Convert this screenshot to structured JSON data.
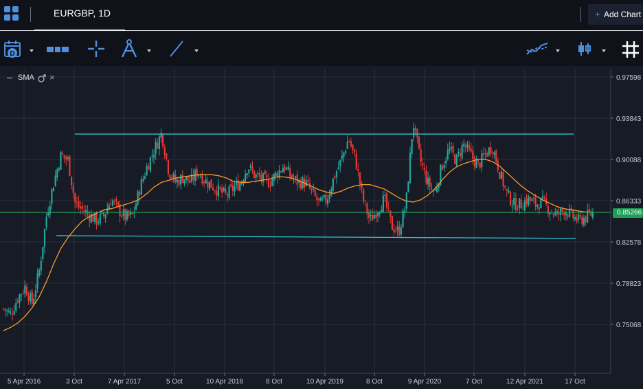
{
  "header": {
    "symbol_tab": "EURGBP, 1D",
    "add_chart_label": "Add Chart",
    "add_chart_plus": "+"
  },
  "toolbar": {
    "tools": [
      "calendar-date-icon",
      "range-bar-icon",
      "crosshair-icon",
      "compass-drawing-icon",
      "trend-line-icon",
      "indicators-icon",
      "candlestick-type-icon",
      "grid-icon"
    ]
  },
  "indicator": {
    "label": "SMA",
    "dash": "—",
    "close": "×"
  },
  "colors": {
    "up": "#26a69a",
    "down": "#e53935",
    "sma": "#f59b2c",
    "channel": "#29c4d1",
    "price_line": "#1f9d55",
    "grid": "#2a2f3b",
    "bg": "#171b26",
    "accent": "#4f8fdc"
  },
  "chart_data": {
    "type": "candlestick",
    "title": "EURGBP, 1D",
    "x_ticks": [
      "5 Apr 2016",
      "3 Oct",
      "7 Apr 2017",
      "5 Oct",
      "10 Apr 2018",
      "8 Oct",
      "10 Apr 2019",
      "8 Oct",
      "9 Apr 2020",
      "7 Oct",
      "12 Apr 2021",
      "17 Oct"
    ],
    "y_ticks": [
      "0.97598",
      "0.93843",
      "0.90088",
      "0.86333",
      "0.82578",
      "0.78823",
      "0.75068"
    ],
    "ylim": [
      0.7444,
      0.982
    ],
    "last_price": "0.85266",
    "indicators": [
      "SMA"
    ],
    "price_series_monthly": [
      0.765,
      0.76,
      0.775,
      0.785,
      0.77,
      0.8,
      0.85,
      0.88,
      0.905,
      0.9,
      0.86,
      0.855,
      0.85,
      0.845,
      0.85,
      0.865,
      0.855,
      0.848,
      0.85,
      0.875,
      0.895,
      0.91,
      0.925,
      0.89,
      0.88,
      0.885,
      0.88,
      0.89,
      0.882,
      0.877,
      0.872,
      0.868,
      0.875,
      0.88,
      0.895,
      0.886,
      0.883,
      0.88,
      0.888,
      0.895,
      0.885,
      0.88,
      0.88,
      0.87,
      0.86,
      0.865,
      0.885,
      0.9,
      0.92,
      0.9,
      0.865,
      0.845,
      0.855,
      0.865,
      0.84,
      0.835,
      0.86,
      0.935,
      0.9,
      0.88,
      0.87,
      0.895,
      0.91,
      0.9,
      0.915,
      0.905,
      0.895,
      0.905,
      0.913,
      0.89,
      0.87,
      0.86,
      0.86,
      0.865,
      0.86,
      0.862,
      0.855,
      0.85,
      0.855,
      0.85,
      0.845,
      0.848,
      0.852
    ],
    "sma_series_monthly": [
      0.745,
      0.748,
      0.752,
      0.758,
      0.766,
      0.776,
      0.79,
      0.806,
      0.82,
      0.83,
      0.838,
      0.845,
      0.849,
      0.852,
      0.855,
      0.856,
      0.858,
      0.86,
      0.862,
      0.865,
      0.87,
      0.876,
      0.88,
      0.882,
      0.884,
      0.885,
      0.886,
      0.887,
      0.887,
      0.887,
      0.886,
      0.884,
      0.881,
      0.88,
      0.88,
      0.881,
      0.882,
      0.883,
      0.885,
      0.885,
      0.884,
      0.882,
      0.879,
      0.876,
      0.873,
      0.871,
      0.87,
      0.872,
      0.875,
      0.877,
      0.878,
      0.878,
      0.876,
      0.874,
      0.87,
      0.866,
      0.863,
      0.862,
      0.864,
      0.868,
      0.874,
      0.882,
      0.889,
      0.894,
      0.897,
      0.899,
      0.901,
      0.901,
      0.899,
      0.895,
      0.889,
      0.883,
      0.877,
      0.872,
      0.868,
      0.864,
      0.861,
      0.858,
      0.856,
      0.855,
      0.854,
      0.853,
      0.853
    ],
    "upper_channel": {
      "from": 0.924,
      "to": 0.924
    },
    "lower_channel": {
      "from": 0.8315,
      "to": 0.829
    },
    "horizontal_line": 0.8527
  }
}
